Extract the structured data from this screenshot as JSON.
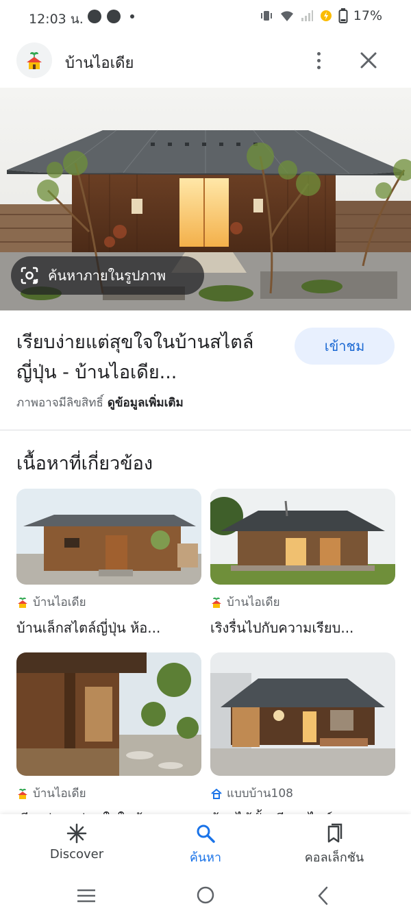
{
  "status_bar": {
    "time": "12:03 น.",
    "battery_percent": "17%",
    "icons": [
      "notification-badge-icon",
      "notification-badge-icon",
      "vibrate-icon",
      "wifi-icon",
      "signal-icon",
      "battery-saver-icon",
      "battery-icon"
    ]
  },
  "header": {
    "site_name": "บ้านไอเดีย",
    "more_icon": "more-vert-icon",
    "close_icon": "close-icon"
  },
  "main_result": {
    "lens_chip_label": "ค้นหาภายในรูปภาพ",
    "title": "เรียบง่ายแต่สุขใจในบ้านสไตล์ญี่ปุ่น - บ้านไอเดีย...",
    "visit_button": "เข้าชม",
    "copyright_notice": "ภาพอาจมีลิขสิทธิ์",
    "more_info_link": "ดูข้อมูลเพิ่มเติม"
  },
  "related": {
    "heading": "เนื้อหาที่เกี่ยวข้อง",
    "items": [
      {
        "source": "บ้านไอเดีย",
        "title": "บ้านเล็กสไตล์ญี่ปุ่น ห้อ..."
      },
      {
        "source": "บ้านไอเดีย",
        "title": "เริงรื่นไปกับความเรียบ..."
      },
      {
        "source": "บ้านไอเดีย",
        "title": "เรียบง่ายแต่สุขใจในบ้า..."
      },
      {
        "source": "แบบบ้าน108",
        "title": "บ้านไม้ชั้นเดียวสไตล์..."
      }
    ]
  },
  "bottom_nav": {
    "items": [
      {
        "label": "Discover",
        "icon": "asterisk-icon"
      },
      {
        "label": "ค้นหา",
        "icon": "search-icon",
        "active": true
      },
      {
        "label": "คอลเล็กชัน",
        "icon": "bookmark-collection-icon"
      }
    ]
  },
  "colors": {
    "accent": "#1a73e8",
    "visit_button_bg": "#e8f0fe",
    "text_primary": "#202124",
    "text_secondary": "#5f6368"
  }
}
